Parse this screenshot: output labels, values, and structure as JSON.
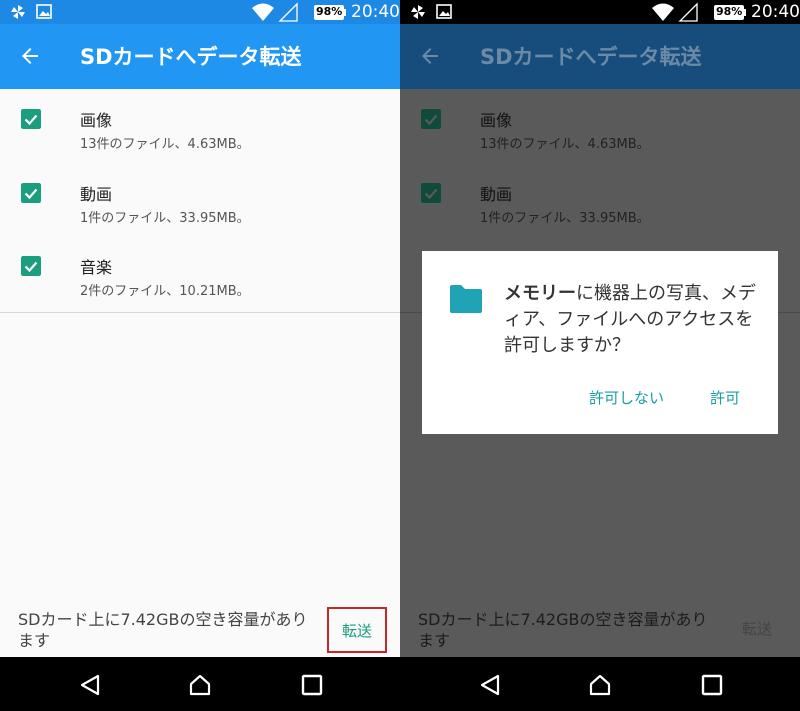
{
  "status_bar": {
    "time": "20:40",
    "battery": "98%"
  },
  "app_bar": {
    "title": "SDカードへデータ転送",
    "color": "#2196f3",
    "dimmed_color": "#174d7c"
  },
  "items": [
    {
      "name": "画像",
      "meta": "13件のファイル、4.63MB。",
      "checked": true
    },
    {
      "name": "動画",
      "meta": "1件のファイル、33.95MB。",
      "checked": true
    },
    {
      "name": "音楽",
      "meta": "2件のファイル、10.21MB。",
      "checked": true
    }
  ],
  "footer": {
    "free_space_text": "SDカード上に7.42GBの空き容量があります",
    "transfer_button": "転送"
  },
  "dialog": {
    "message_bold": "メモリー",
    "message_rest": "に機器上の写真、メディア、ファイルへのアクセスを許可しますか？",
    "deny_button": "許可しない",
    "allow_button": "許可",
    "icon": "folder-icon"
  },
  "colors": {
    "accent": "#1a9e7e",
    "dialog_button": "#1a9ea3",
    "highlight_border": "#c62828"
  }
}
